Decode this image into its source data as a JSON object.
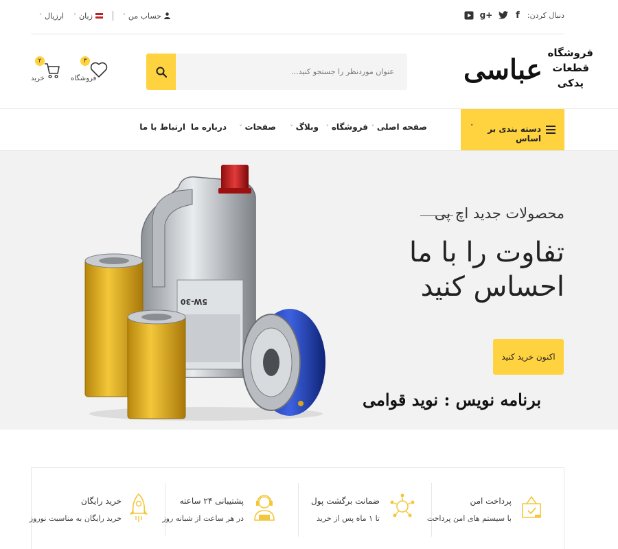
{
  "topbar": {
    "follow_label": "دنبال کردن:",
    "social": [
      {
        "name": "facebook",
        "glyph": "f"
      },
      {
        "name": "twitter",
        "glyph": "t"
      },
      {
        "name": "google-plus",
        "glyph": "g+"
      },
      {
        "name": "youtube",
        "glyph": "▶"
      }
    ],
    "account_label": "حساب من",
    "language_label": "زبان",
    "currency_label": "ارزیال"
  },
  "logo": {
    "main": "عباسی",
    "side_line1": "فروشگاه",
    "side_line2": "قطعات",
    "side_line3": "یدکی"
  },
  "search": {
    "placeholder": "عنوان موردنظر را جستجو کنید..."
  },
  "header_icons": {
    "wishlist_label": "فروشگاه",
    "wishlist_count": "۳",
    "cart_label": "خرید",
    "cart_count": "۲"
  },
  "nav": {
    "category_label": "دسته بندی بر اساس",
    "items": [
      {
        "label": "صفحه اصلی",
        "dropdown": true
      },
      {
        "label": "فروشگاه",
        "dropdown": true
      },
      {
        "label": "وبلاگ",
        "dropdown": true
      },
      {
        "label": "صفحات",
        "dropdown": true
      },
      {
        "label": "درباره ما",
        "dropdown": false
      },
      {
        "label": "ارتباط با ما",
        "dropdown": false
      }
    ]
  },
  "hero": {
    "kicker": "محصولات جدید اچ پی",
    "title": "تفاوت را با ما احساس کنید",
    "button_label": "اکنون خرید کنید",
    "credit": "برنامه نویس : نوید قوامی"
  },
  "features": [
    {
      "title": "پرداخت امن",
      "subtitle": "با سیستم های امن پرداخت",
      "icon": "wallet-icon"
    },
    {
      "title": "ضمانت برگشت پول",
      "subtitle": "تا ۱ ماه پس از خرید",
      "icon": "money-back-icon"
    },
    {
      "title": "پشتیبانی ۲۴ ساعته",
      "subtitle": "در هر ساعت از شبانه روز",
      "icon": "support-agent-icon"
    },
    {
      "title": "خرید رایگان",
      "subtitle": "خرید رایگان به مناسبت نوروز",
      "icon": "rocket-icon"
    }
  ],
  "colors": {
    "accent": "#ffd240",
    "hero_bg": "#f2f2f2",
    "text": "#222222"
  }
}
